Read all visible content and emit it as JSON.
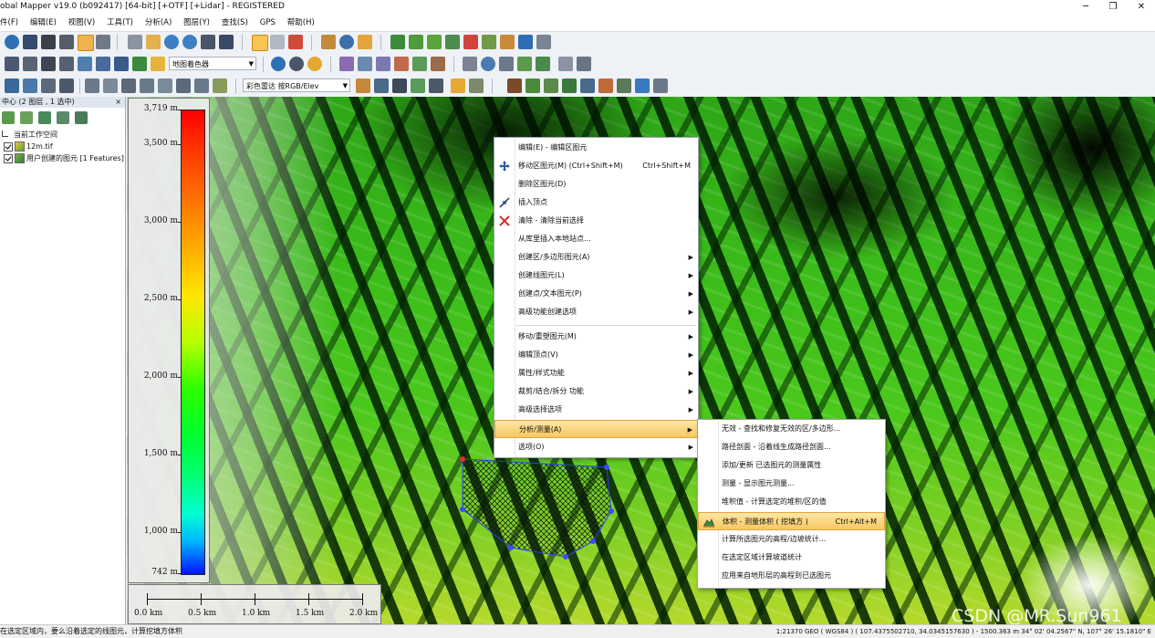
{
  "window": {
    "title": "obal Mapper v19.0 (b092417) [64-bit] [+OTF] [+Lidar] - REGISTERED",
    "minimize": "─",
    "restore": "❐",
    "close": "✕"
  },
  "menu": [
    "件(F)",
    "编辑(E)",
    "视图(V)",
    "工具(T)",
    "分析(A)",
    "图层(Y)",
    "查找(S)",
    "GPS",
    "帮助(H)"
  ],
  "toolbar": {
    "map_combo": "地图着色器",
    "shader_combo": "彩色雷达 按RGB/Elev"
  },
  "left_panel": {
    "header": "中心 (2 图层 , 1 选中)",
    "close": "×",
    "tree": {
      "workspace": "当前工作空间",
      "layer1": "12m.tif",
      "layer2": "用户创建的图元 [1 Features]"
    }
  },
  "legend": {
    "ticks": [
      "3,719 m",
      "3,500 m",
      "3,000 m",
      "2,500 m",
      "2,000 m",
      "1,500 m",
      "1,000 m",
      "742 m"
    ]
  },
  "scalebar": {
    "labels": [
      "0.0 km",
      "0.5 km",
      "1.0 km",
      "1.5 km",
      "2.0 km"
    ]
  },
  "context_menu": {
    "items": [
      {
        "label": "编辑(E) - 编辑区图元"
      },
      {
        "label": "移动区图元(M) (Ctrl+Shift+M)",
        "shortcut": "Ctrl+Shift+M"
      },
      {
        "label": "删除区图元(D)"
      },
      {
        "label": "插入顶点"
      },
      {
        "label": "清除 - 清除当前选择"
      },
      {
        "label": "从库里插入本地站点..."
      },
      {
        "label": "创建区/多边形图元(A)"
      },
      {
        "label": "创建线图元(L)"
      },
      {
        "label": "创建点/文本图元(P)"
      },
      {
        "label": "高级功能创建选项"
      },
      {
        "label": "移动/重塑图元(M)"
      },
      {
        "label": "编辑顶点(V)"
      },
      {
        "label": "属性/样式功能"
      },
      {
        "label": "裁剪/结合/拆分 功能"
      },
      {
        "label": "高级选择选项"
      },
      {
        "label": "分析/测量(A)"
      },
      {
        "label": "选项(O)"
      }
    ],
    "submenu_arrow": "▶"
  },
  "submenu": {
    "items": [
      {
        "label": "无效 - 查找和修复无效的区/多边形..."
      },
      {
        "label": "路径剖面 - 沿着线生成路径剖面..."
      },
      {
        "label": "添加/更新 已选图元的测量属性"
      },
      {
        "label": "测量 - 显示图元测量..."
      },
      {
        "label": "堆积值 - 计算选定的堆积/区的值"
      },
      {
        "label": "体积 - 测量体积 ( 挖填方 )",
        "shortcut": "Ctrl+Alt+M"
      },
      {
        "label": "计算所选图元的高程/边坡统计..."
      },
      {
        "label": "在选定区域计算坡道统计"
      },
      {
        "label": "应用来自地形层的高程到已选图元"
      }
    ]
  },
  "status": {
    "hint": "在选定区域内，要么沿着选定的线图元，计算挖填方体积",
    "coords": "1:21370  GEO ( WGS84 ) ( 107.4375502710, 34.0345157630 ) - 1500.363 m  34° 02' 04.2567\" N, 107° 26' 15.1810\" E"
  },
  "watermark": "CSDN @MR.Sun961",
  "colors": {
    "menu_highlight": "#f8c761",
    "toolbar_bg": "#eef1f6"
  }
}
